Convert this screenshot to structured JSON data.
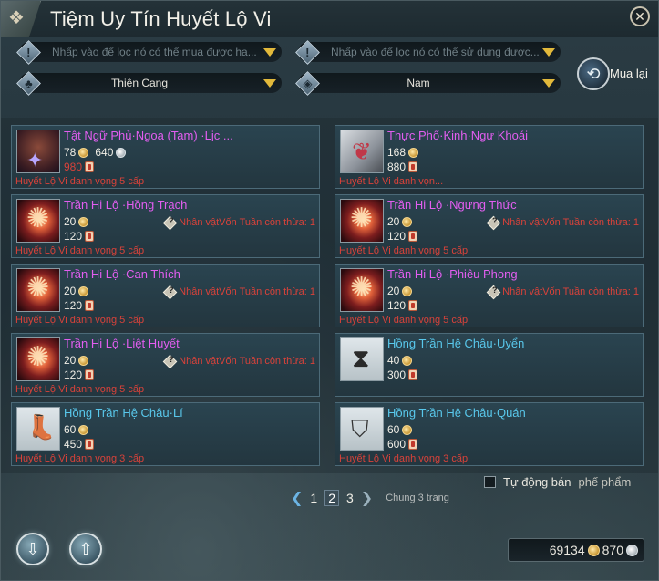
{
  "window": {
    "title": "Tiệm Uy Tín Huyết Lộ Vi",
    "close_symbol": "✕"
  },
  "filters": {
    "buy_filter_placeholder": "Nhấp vào để lọc nó có thể  mua được ha...",
    "use_filter_placeholder": "Nhấp vào để lọc nó có thể sử dụng được...",
    "faction_value": "Thiên Cang",
    "gender_value": "Nam"
  },
  "buyback": {
    "label": "Mua lại"
  },
  "items": [
    {
      "name": "Tật Ngữ Phủ·Ngoa (Tam) ·Lịc ...",
      "name_color": "purple",
      "icon": "armor-icon",
      "price_gold": "78",
      "price_silver": "640",
      "price_token": "980",
      "token_insufficient": true,
      "requirement": "Huyết Lộ Vi danh vọng 5 cấp",
      "limit": ""
    },
    {
      "name": "Thực Phổ·Kinh·Ngư Khoái",
      "name_color": "purple",
      "icon": "book-icon",
      "price_gold": "168",
      "price_silver": "",
      "price_token": "880",
      "token_insufficient": false,
      "requirement": "Huyết Lộ Vi danh vọn...",
      "limit": ""
    },
    {
      "name": "Trần Hi Lộ ·Hồng Trạch",
      "name_color": "purple",
      "icon": "hi-lo-icon",
      "price_gold": "20",
      "price_silver": "",
      "price_token": "120",
      "token_insufficient": false,
      "requirement": "Huyết Lộ Vi danh vọng 5 cấp",
      "limit": "Nhân vậtVốn Tuần còn thừa: 1"
    },
    {
      "name": "Trần Hi Lộ ·Ngưng Thức",
      "name_color": "purple",
      "icon": "hi-lo-icon",
      "price_gold": "20",
      "price_silver": "",
      "price_token": "120",
      "token_insufficient": false,
      "requirement": "Huyết Lộ Vi danh vọng 5 cấp",
      "limit": "Nhân vậtVốn Tuần còn thừa: 1"
    },
    {
      "name": "Trần Hi Lộ ·Can Thích",
      "name_color": "purple",
      "icon": "hi-lo-icon",
      "price_gold": "20",
      "price_silver": "",
      "price_token": "120",
      "token_insufficient": false,
      "requirement": "Huyết Lộ Vi danh vọng 5 cấp",
      "limit": "Nhân vậtVốn Tuần còn thừa: 1"
    },
    {
      "name": "Trần Hi Lộ ·Phiêu Phong",
      "name_color": "purple",
      "icon": "hi-lo-icon",
      "price_gold": "20",
      "price_silver": "",
      "price_token": "120",
      "token_insufficient": false,
      "requirement": "Huyết Lộ Vi danh vọng 5 cấp",
      "limit": "Nhân vậtVốn Tuần còn thừa: 1"
    },
    {
      "name": "Trần Hi Lộ ·Liệt Huyết",
      "name_color": "purple",
      "icon": "hi-lo-icon",
      "price_gold": "20",
      "price_silver": "",
      "price_token": "120",
      "token_insufficient": false,
      "requirement": "Huyết Lộ Vi danh vọng 5 cấp",
      "limit": "Nhân vậtVốn Tuần còn thừa: 1"
    },
    {
      "name": "Hồng Trần Hệ Châu·Uyển",
      "name_color": "blue",
      "icon": "pouch-icon",
      "price_gold": "40",
      "price_silver": "",
      "price_token": "300",
      "token_insufficient": false,
      "requirement": "",
      "limit": ""
    },
    {
      "name": "Hồng Trần Hệ Châu·Lí",
      "name_color": "blue",
      "icon": "boot-icon",
      "price_gold": "60",
      "price_silver": "",
      "price_token": "450",
      "token_insufficient": false,
      "requirement": "Huyết Lộ Vi danh vọng 3 cấp",
      "limit": ""
    },
    {
      "name": "Hồng Trần Hệ Châu·Quán",
      "name_color": "blue",
      "icon": "cap-icon",
      "price_gold": "60",
      "price_silver": "",
      "price_token": "600",
      "token_insufficient": false,
      "requirement": "Huyết Lộ Vi danh vọng 3 cấp",
      "limit": ""
    }
  ],
  "auto_sell": {
    "label": "Tự động bán",
    "hint": "phế phẩm"
  },
  "pagination": {
    "pages": [
      "1",
      "2",
      "3"
    ],
    "current": "2",
    "total_label": "Chung 3 trang"
  },
  "wallet": {
    "gold": "69134",
    "silver": "870"
  },
  "colors": {
    "purple_name": "#e25ef0",
    "blue_name": "#59c8ec",
    "requirement_red": "#d8423a",
    "dropdown_arrow": "#e2b93b"
  }
}
